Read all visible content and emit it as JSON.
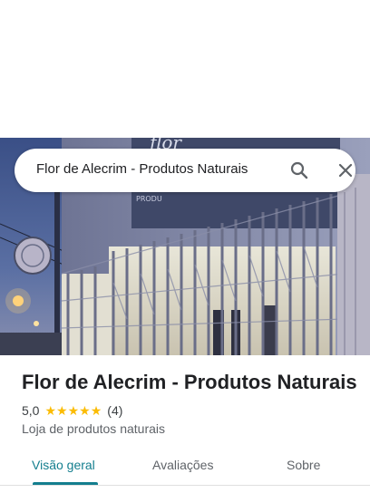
{
  "search": {
    "query": "Flor de Alecrim - Produtos Naturais"
  },
  "place": {
    "name": "Flor de Alecrim - Produtos Naturais",
    "rating": "5,0",
    "stars": 5,
    "review_count": "(4)",
    "category": "Loja de produtos naturais",
    "star_color": "#fbbc04"
  },
  "tabs": [
    {
      "label": "Visão geral",
      "active": true
    },
    {
      "label": "Avaliações",
      "active": false
    },
    {
      "label": "Sobre",
      "active": false
    }
  ],
  "colors": {
    "accent": "#137e8e"
  },
  "icons": {
    "search": "search-icon",
    "close": "close-icon",
    "star": "star-icon"
  }
}
